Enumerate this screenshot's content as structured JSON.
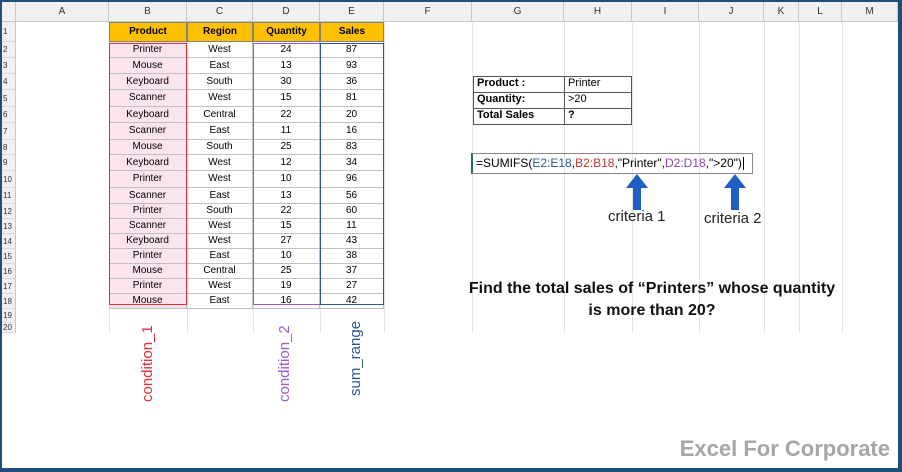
{
  "columns": [
    "A",
    "B",
    "C",
    "D",
    "E",
    "F",
    "G",
    "H",
    "I",
    "J",
    "K",
    "L",
    "M"
  ],
  "rows": [
    "1",
    "2",
    "3",
    "4",
    "5",
    "6",
    "7",
    "8",
    "9",
    "10",
    "11",
    "12",
    "13",
    "14",
    "15",
    "16",
    "17",
    "18",
    "19",
    "20"
  ],
  "table": {
    "headers": [
      "Product",
      "Region",
      "Quantity",
      "Sales"
    ],
    "rows": [
      [
        "Printer",
        "West",
        "24",
        "87"
      ],
      [
        "Mouse",
        "East",
        "13",
        "93"
      ],
      [
        "Keyboard",
        "South",
        "30",
        "36"
      ],
      [
        "Scanner",
        "West",
        "15",
        "81"
      ],
      [
        "Keyboard",
        "Central",
        "22",
        "20"
      ],
      [
        "Scanner",
        "East",
        "11",
        "16"
      ],
      [
        "Mouse",
        "South",
        "25",
        "83"
      ],
      [
        "Keyboard",
        "West",
        "12",
        "34"
      ],
      [
        "Printer",
        "West",
        "10",
        "96"
      ],
      [
        "Scanner",
        "East",
        "13",
        "56"
      ],
      [
        "Printer",
        "South",
        "22",
        "60"
      ],
      [
        "Scanner",
        "West",
        "15",
        "11"
      ],
      [
        "Keyboard",
        "West",
        "27",
        "43"
      ],
      [
        "Printer",
        "East",
        "10",
        "38"
      ],
      [
        "Mouse",
        "Central",
        "25",
        "37"
      ],
      [
        "Printer",
        "West",
        "19",
        "27"
      ],
      [
        "Mouse",
        "East",
        "16",
        "42"
      ]
    ]
  },
  "criteria_box": {
    "product_label": "Product :",
    "product_value": "Printer",
    "quantity_label": "Quantity:",
    "quantity_value": ">20",
    "sales_label": "Total Sales",
    "sales_value": "?"
  },
  "formula": {
    "prefix": "=SUMIFS(",
    "arg1": "E2:E18",
    "comma1": ",",
    "arg2": "B2:B18",
    "comma2": ",",
    "arg3": "\"Printer\"",
    "comma3": ",",
    "arg4": "D2:D18",
    "comma4": ",",
    "arg5": "\">20\"",
    "suffix": ")"
  },
  "annotations": {
    "criteria1": "criteria 1",
    "criteria2": "criteria 2",
    "condition1": "condition_1",
    "condition2": "condition_2",
    "sum_range": "sum_range"
  },
  "question": {
    "line1": "Find the total sales of “Printers” whose quantity",
    "line2": "is more than 20?"
  },
  "brand": "Excel For Corporate",
  "colors": {
    "header_fill": "#ffc000",
    "condition1": "#e0303a",
    "condition2": "#9b59d0",
    "sum_range": "#2f5597",
    "arrow": "#1f5fbf",
    "frame": "#1f4e79"
  }
}
